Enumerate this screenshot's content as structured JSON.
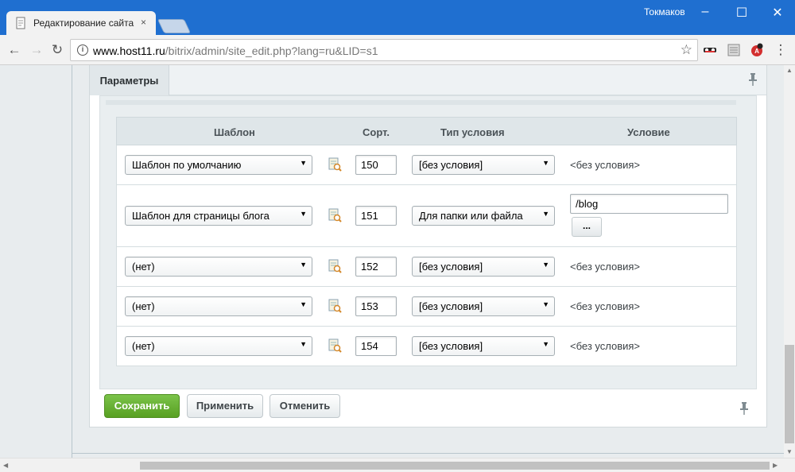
{
  "browser": {
    "tab_title": "Редактирование сайта",
    "tab_close": "×",
    "user": "Токмаков",
    "url_host": "www.host11.ru",
    "url_path": "/bitrix/admin/site_edit.php?lang=ru&LID=s1"
  },
  "panel": {
    "tab_label": "Параметры"
  },
  "grid": {
    "headers": {
      "template": "Шаблон",
      "sort": "Сорт.",
      "condition_type": "Тип условия",
      "condition": "Условие"
    },
    "rows": [
      {
        "template": "Шаблон по умолчанию",
        "sort": "150",
        "condition_type": "[без условия]",
        "condition": "<без условия>"
      },
      {
        "template": "Шаблон для страницы блога",
        "sort": "151",
        "condition_type": "Для папки или файла",
        "condition_value": "/blog",
        "browse_label": "..."
      },
      {
        "template": "(нет)",
        "sort": "152",
        "condition_type": "[без условия]",
        "condition": "<без условия>"
      },
      {
        "template": "(нет)",
        "sort": "153",
        "condition_type": "[без условия]",
        "condition": "<без условия>"
      },
      {
        "template": "(нет)",
        "sort": "154",
        "condition_type": "[без условия]",
        "condition": "<без условия>"
      }
    ]
  },
  "buttons": {
    "save": "Сохранить",
    "apply": "Применить",
    "cancel": "Отменить"
  },
  "icons": {
    "select_arrow": "▼",
    "pin": "📌"
  },
  "colors": {
    "titlebar": "#1f6fd0",
    "save_button": "#65b02f"
  }
}
